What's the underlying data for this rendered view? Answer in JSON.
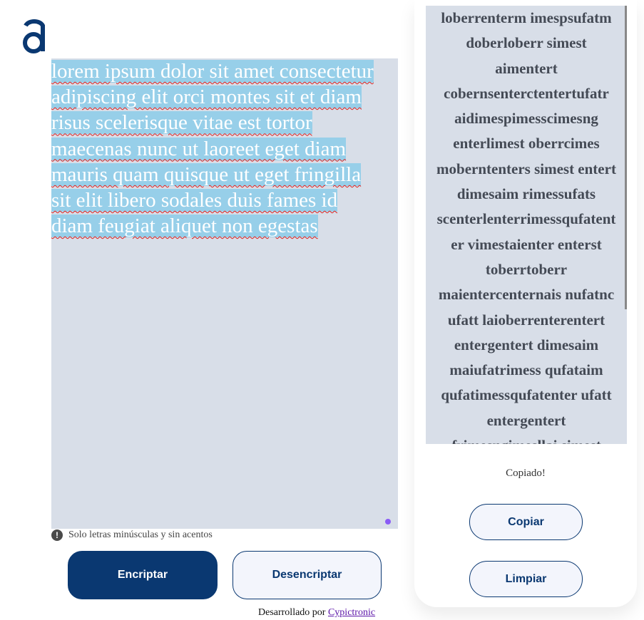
{
  "brand": {
    "logo_icon": "alura-a-logo",
    "color": "#0a3871"
  },
  "input": {
    "text": "lorem ipsum dolor sit amet consectetur adipiscing elit orci montes sit et diam risus scelerisque vitae est tortor maecenas nunc ut laoreet eget diam mauris quam quisque ut eget fringilla sit elit libero sodales duis fames id diam feugiat aliquet non egestas",
    "lines": [
      "lorem ipsum dolor sit amet consectetur",
      "adipiscing elit orci montes sit et diam",
      "risus scelerisque vitae est tortor",
      "maecenas nunc ut laoreet eget diam",
      "mauris quam quisque ut eget fringilla",
      "sit elit libero sodales duis fames id",
      "diam feugiat aliquet non egestas"
    ]
  },
  "hint": {
    "icon": "exclamation-circle-icon",
    "text": "Solo letras minúsculas y sin acentos"
  },
  "buttons": {
    "encrypt": "Encriptar",
    "decrypt": "Desencriptar",
    "copy": "Copiar",
    "clear": "Limpiar"
  },
  "output": {
    "lines": [
      "loberrenterm imespsufatm",
      "doberloberr simest",
      "aimentert",
      "cobernsenterctentertufatr",
      "aidimespimesscimesng",
      "enterlimest oberrcimes",
      "moberntenters simest entert",
      "dimesaim rimessufats",
      "scenterlenterrimessqufatent",
      "er vimestaienter enterst",
      "toberrtoberr",
      "maientercenternais nufatnc",
      "ufatt laioberrenterentert",
      "entergentert dimesaim",
      "maiufatrimess qufataim",
      "qufatimessqufatenter ufatt",
      "entergentert",
      "frimesngimesllai simest"
    ],
    "status": "Copiado!"
  },
  "footer": {
    "prefix": "Desarrollado por",
    "link_text": "Cypictronic"
  }
}
